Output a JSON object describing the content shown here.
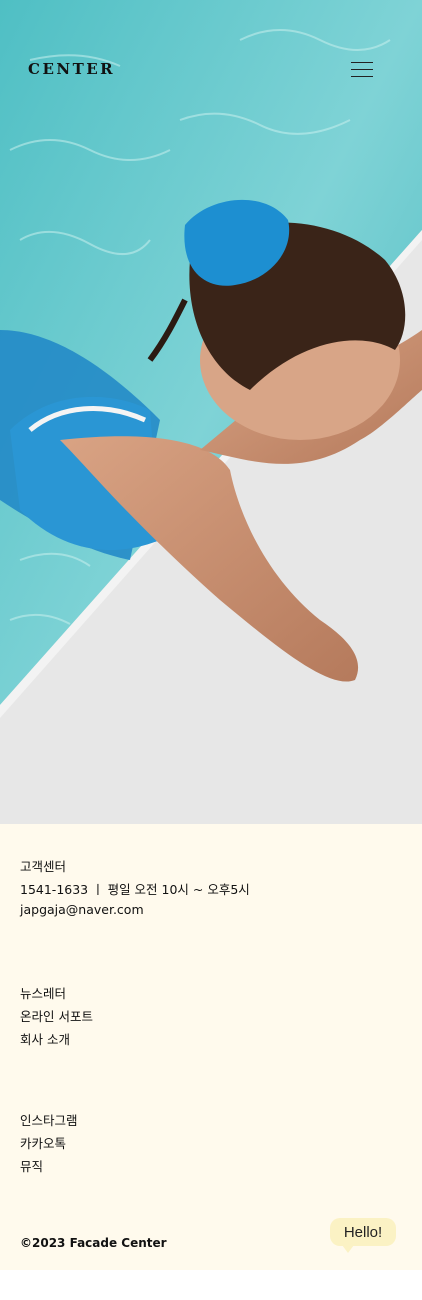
{
  "header": {
    "logo": "CENTER",
    "menu_icon": "hamburger-menu-icon"
  },
  "hero": {
    "image": "woman-in-swimming-pool-photo",
    "colors": {
      "water": "#59c3c8",
      "deck": "#e8e8e8",
      "scrunchie": "#1d8fd1"
    }
  },
  "footer": {
    "customer_center": {
      "title": "고객센터",
      "hours": "1541-1633 ㅣ 평일 오전 10시 ~ 오후5시",
      "email": "japgaja@naver.com"
    },
    "links": [
      "뉴스레터",
      "온라인 서포트",
      "회사 소개"
    ],
    "social": [
      "인스타그램",
      "카카오톡",
      "뮤직"
    ],
    "copyright": "©2023 Facade Center",
    "chat_bubble": "Hello!"
  }
}
